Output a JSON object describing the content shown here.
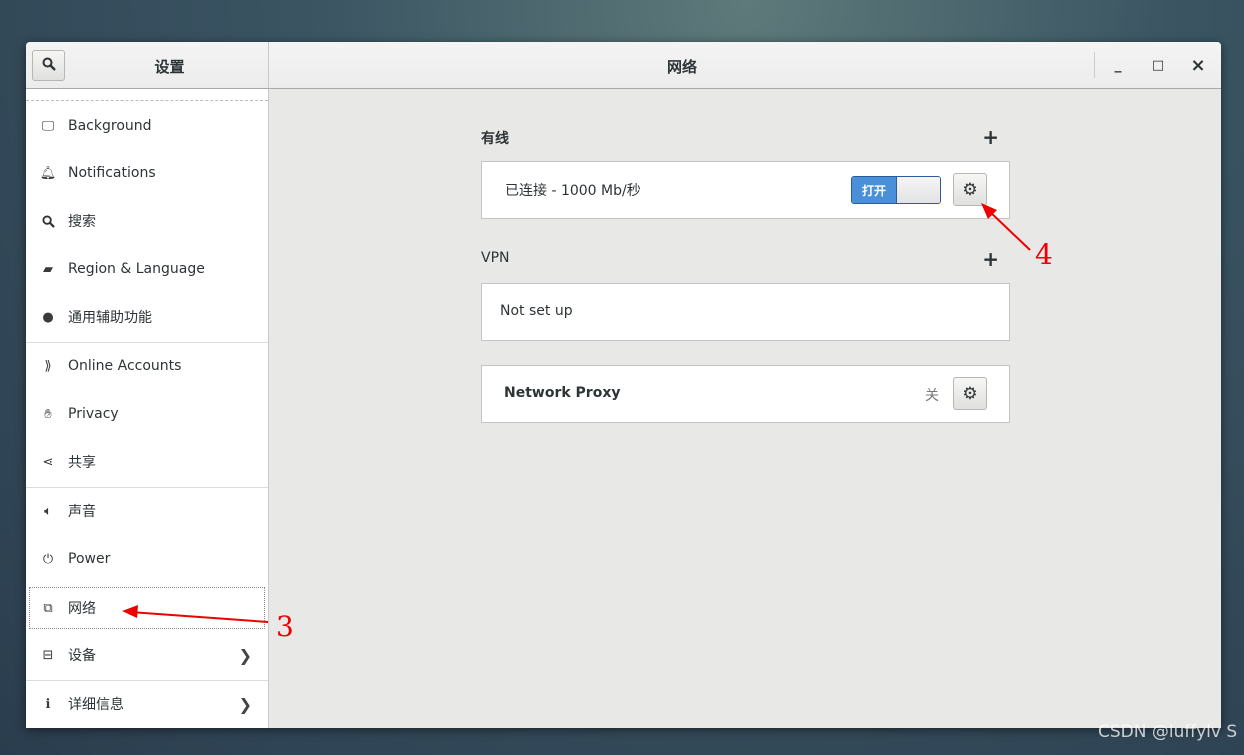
{
  "header": {
    "sidebar_title": "设置",
    "panel_title": "网络",
    "minimize": "_",
    "maximize": "□",
    "close": "×"
  },
  "sidebar": {
    "items": [
      {
        "label": "Background",
        "icon": "monitor-icon"
      },
      {
        "label": "Notifications",
        "icon": "bell-icon"
      },
      {
        "label": "搜索",
        "icon": "search-icon"
      },
      {
        "label": "Region & Language",
        "icon": "flag-icon"
      },
      {
        "label": "通用辅助功能",
        "icon": "accessibility-icon"
      },
      {
        "label": "Online Accounts",
        "icon": "online-accounts-icon"
      },
      {
        "label": "Privacy",
        "icon": "hand-icon"
      },
      {
        "label": "共享",
        "icon": "share-icon"
      },
      {
        "label": "声音",
        "icon": "speaker-icon"
      },
      {
        "label": "Power",
        "icon": "power-plug-icon"
      },
      {
        "label": "网络",
        "icon": "network-icon"
      },
      {
        "label": "设备",
        "icon": "devices-icon"
      },
      {
        "label": "详细信息",
        "icon": "info-icon"
      }
    ]
  },
  "main": {
    "wired": {
      "title": "有线",
      "add": "+",
      "status": "已连接 - 1000 Mb/秒",
      "toggle": "打开",
      "toggle_on": true
    },
    "vpn": {
      "title": "VPN",
      "add": "+",
      "status": "Not set up"
    },
    "proxy": {
      "label": "Network Proxy",
      "state": "关"
    }
  },
  "annotations": {
    "a3": "3",
    "a4": "4",
    "watermark": "CSDN @luffylv S"
  },
  "colors": {
    "accent": "#4a90d9",
    "annotation": "#e00000"
  }
}
